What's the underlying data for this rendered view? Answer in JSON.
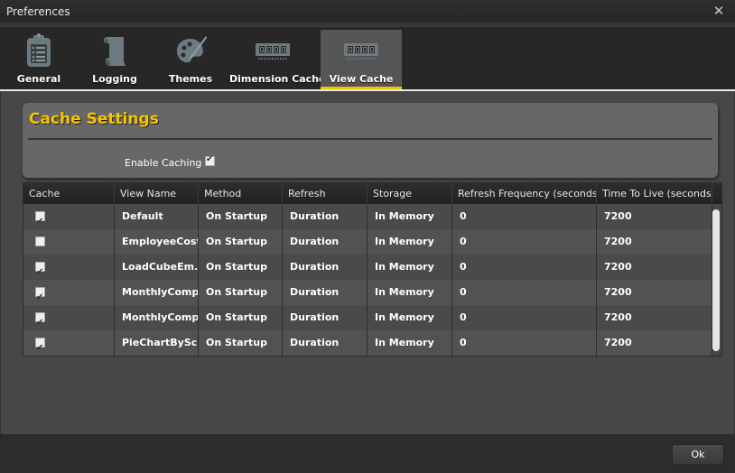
{
  "window": {
    "title": "Preferences",
    "close_icon": "close-icon"
  },
  "tabs": [
    {
      "label": "General",
      "icon": "clipboard-list-icon",
      "active": false
    },
    {
      "label": "Logging",
      "icon": "scroll-icon",
      "active": false
    },
    {
      "label": "Themes",
      "icon": "palette-icon",
      "active": false
    },
    {
      "label": "Dimension Cache",
      "icon": "memory-chip-icon",
      "active": false
    },
    {
      "label": "View Cache",
      "icon": "memory-chip-icon",
      "active": true
    }
  ],
  "settings": {
    "heading": "Cache Settings",
    "enable_caching_label": "Enable Caching",
    "enable_caching_checked": true
  },
  "grid": {
    "columns": [
      "Cache",
      "View Name",
      "Method",
      "Refresh",
      "Storage",
      "Refresh Frequency (seconds)",
      "Time To Live (seconds)"
    ],
    "rows": [
      {
        "cache": true,
        "view_name": "Default",
        "method": "On Startup",
        "refresh": "Duration",
        "storage": "In Memory",
        "refresh_frequency": "0",
        "ttl": "7200"
      },
      {
        "cache": false,
        "view_name": "EmployeeCost",
        "method": "On Startup",
        "refresh": "Duration",
        "storage": "In Memory",
        "refresh_frequency": "0",
        "ttl": "7200"
      },
      {
        "cache": true,
        "view_name": "LoadCubeEm...",
        "method": "On Startup",
        "refresh": "Duration",
        "storage": "In Memory",
        "refresh_frequency": "0",
        "ttl": "7200"
      },
      {
        "cache": true,
        "view_name": "MonthlyComp",
        "method": "On Startup",
        "refresh": "Duration",
        "storage": "In Memory",
        "refresh_frequency": "0",
        "ttl": "7200"
      },
      {
        "cache": true,
        "view_name": "MonthlyComp...",
        "method": "On Startup",
        "refresh": "Duration",
        "storage": "In Memory",
        "refresh_frequency": "0",
        "ttl": "7200"
      },
      {
        "cache": true,
        "view_name": "PieChartBySc...",
        "method": "On Startup",
        "refresh": "Duration",
        "storage": "In Memory",
        "refresh_frequency": "0",
        "ttl": "7200"
      }
    ]
  },
  "footer": {
    "ok_label": "Ok"
  },
  "colors": {
    "accent": "#f5c400",
    "panel": "#676767",
    "background": "#474747"
  }
}
